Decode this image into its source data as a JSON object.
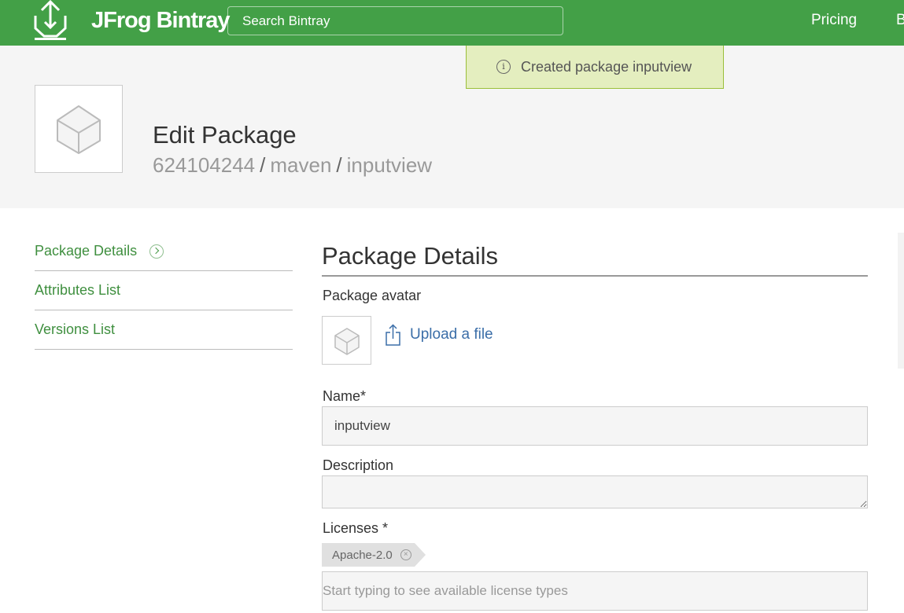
{
  "header": {
    "brand": "JFrog Bintray",
    "search_placeholder": "Search Bintray",
    "nav": {
      "pricing": "Pricing",
      "more": "B"
    }
  },
  "toast": {
    "message": "Created package inputview"
  },
  "page": {
    "title": "Edit Package",
    "breadcrumb": [
      "624104244",
      "maven",
      "inputview"
    ]
  },
  "sidenav": {
    "items": [
      {
        "label": "Package Details",
        "active": true
      },
      {
        "label": "Attributes List"
      },
      {
        "label": "Versions List"
      }
    ]
  },
  "form": {
    "section_title": "Package Details",
    "avatar_label": "Package avatar",
    "upload_label": "Upload a file",
    "name_label": "Name*",
    "name_value": "inputview",
    "description_label": "Description",
    "description_value": "",
    "licenses_label": "Licenses *",
    "licenses": [
      "Apache-2.0"
    ],
    "license_placeholder": "Start typing to see available license types"
  },
  "colors": {
    "topbar": "#43a047",
    "nav_link": "#3f8f3f",
    "toast_bg": "#e4eebf",
    "upload_link": "#3b6ea8"
  }
}
